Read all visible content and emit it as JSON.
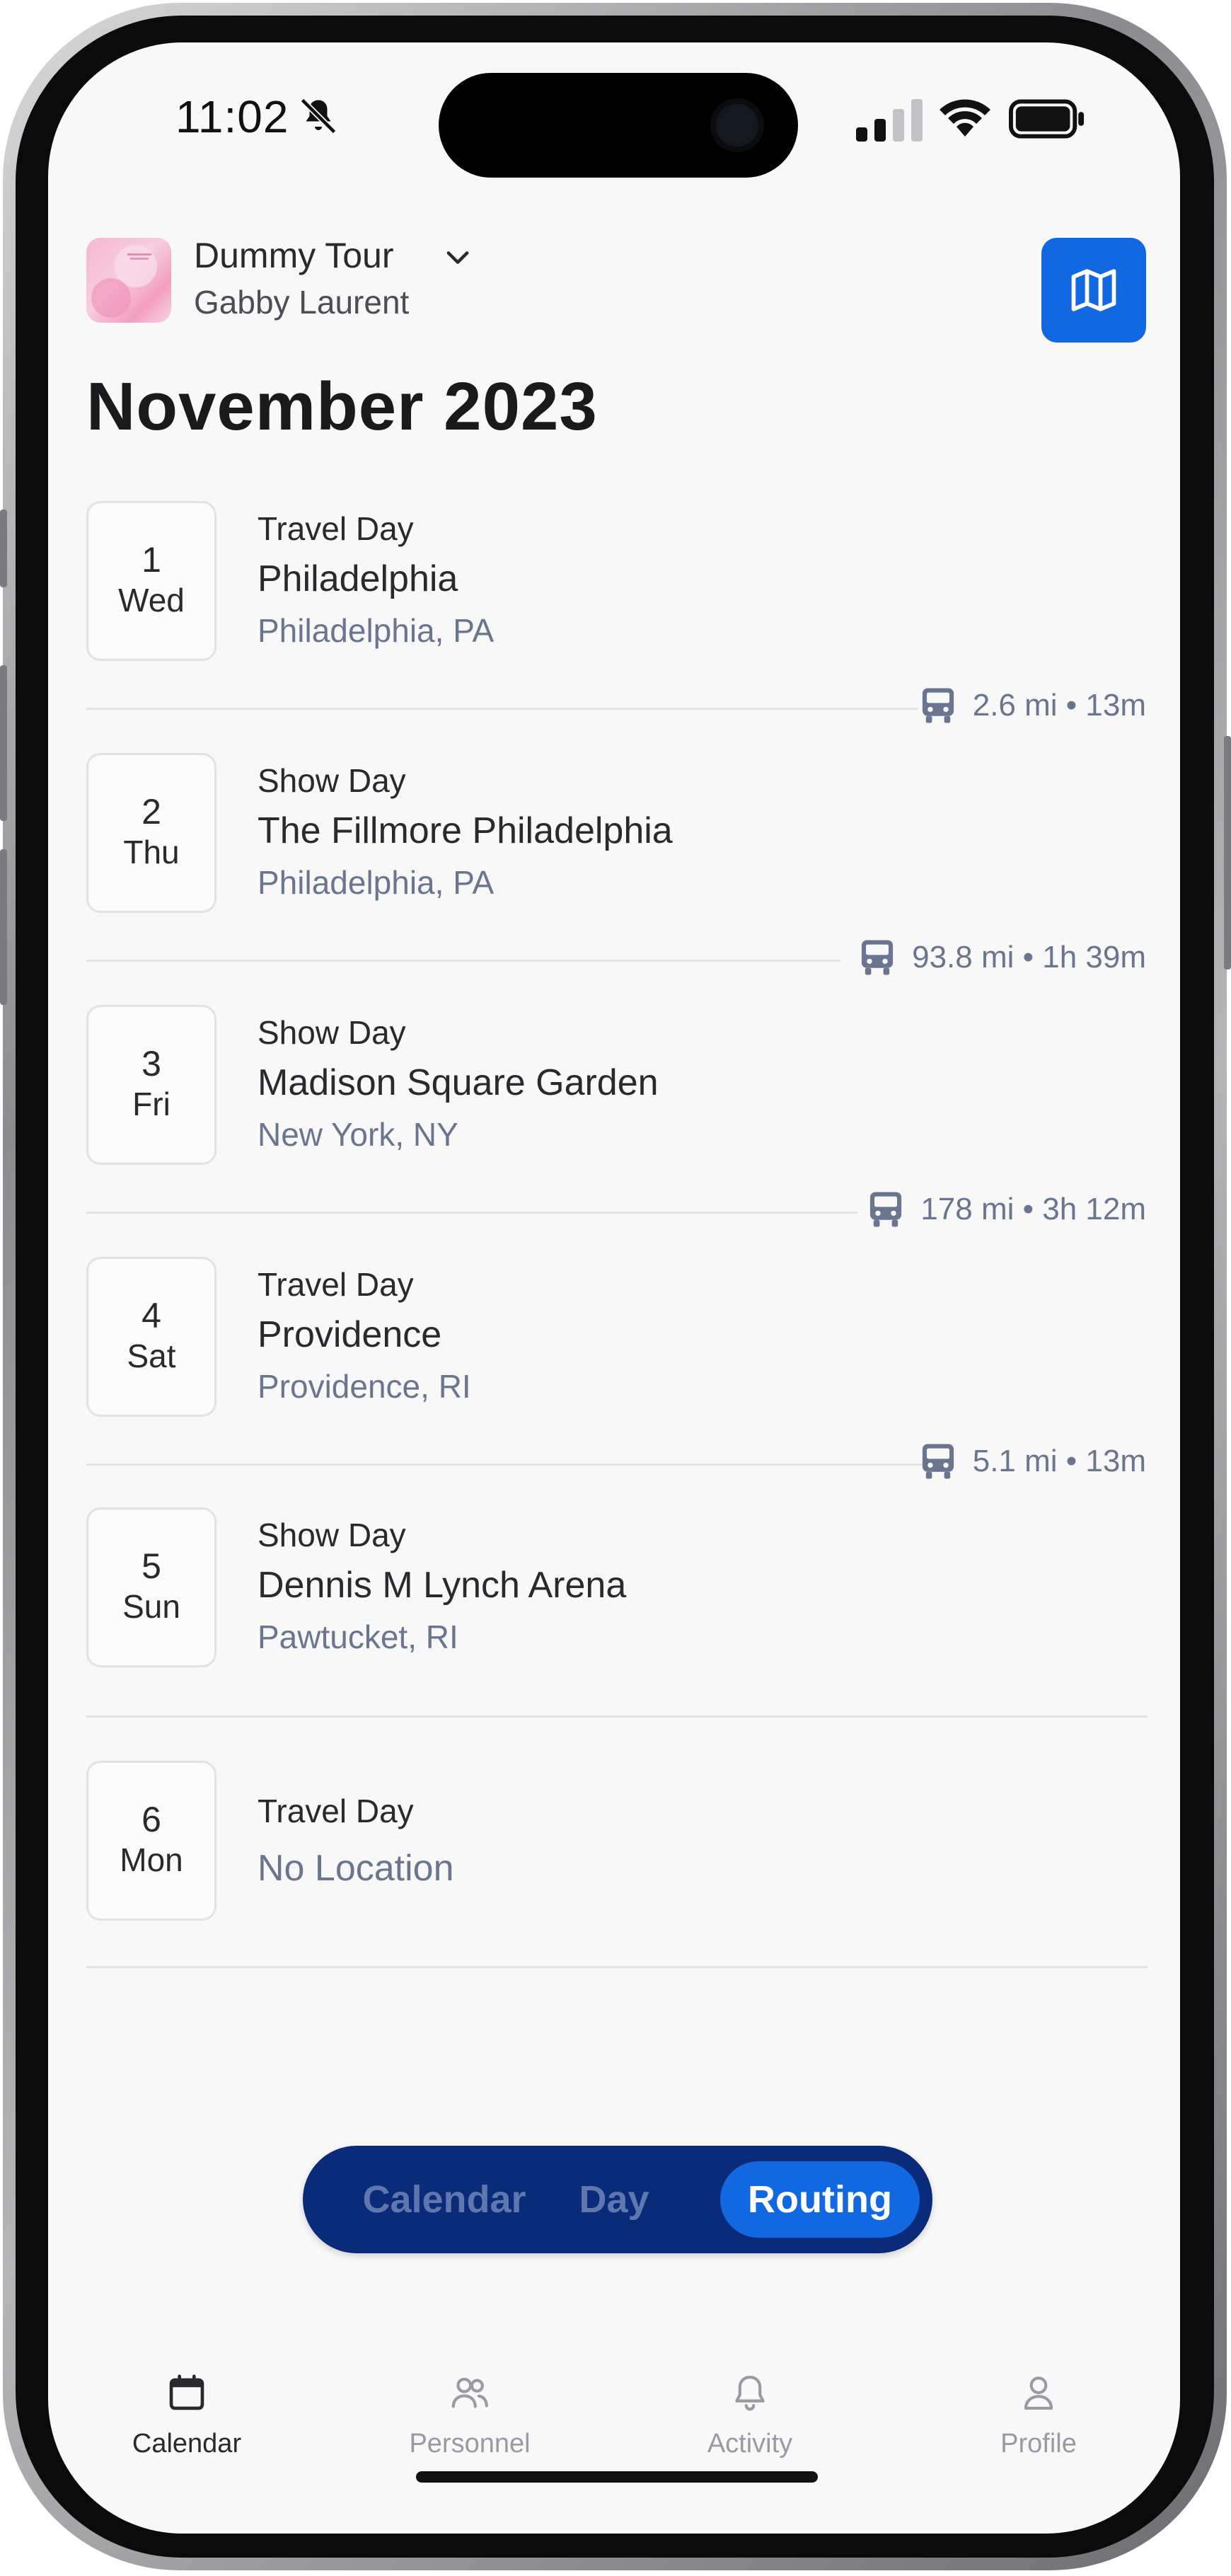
{
  "status_bar": {
    "time": "11:02"
  },
  "header": {
    "tour_name": "Dummy Tour",
    "person": "Gabby Laurent",
    "title": "November 2023"
  },
  "days": [
    {
      "num": "1",
      "dow": "Wed",
      "type": "Travel Day",
      "venue": "Philadelphia",
      "city": "Philadelphia, PA"
    },
    {
      "num": "2",
      "dow": "Thu",
      "type": "Show Day",
      "venue": "The Fillmore Philadelphia",
      "city": "Philadelphia, PA"
    },
    {
      "num": "3",
      "dow": "Fri",
      "type": "Show Day",
      "venue": "Madison Square Garden",
      "city": "New York, NY"
    },
    {
      "num": "4",
      "dow": "Sat",
      "type": "Travel Day",
      "venue": "Providence",
      "city": "Providence, RI"
    },
    {
      "num": "5",
      "dow": "Sun",
      "type": "Show Day",
      "venue": "Dennis M Lynch Arena",
      "city": "Pawtucket, RI"
    },
    {
      "num": "6",
      "dow": "Mon",
      "type": "Travel Day",
      "location": "No Location"
    }
  ],
  "travel": [
    "2.6 mi • 13m",
    "93.8 mi • 1h 39m",
    "178 mi • 3h 12m",
    "5.1 mi • 13m"
  ],
  "view_switcher": {
    "calendar": "Calendar",
    "day": "Day",
    "routing": "Routing",
    "selected": "Routing"
  },
  "tabs": [
    {
      "label": "Calendar",
      "icon": "calendar-icon",
      "active": true
    },
    {
      "label": "Personnel",
      "icon": "people-icon",
      "active": false
    },
    {
      "label": "Activity",
      "icon": "bell-icon",
      "active": false
    },
    {
      "label": "Profile",
      "icon": "person-icon",
      "active": false
    }
  ],
  "colors": {
    "accent": "#1268e0",
    "switcher_bg": "#0a2a7a",
    "secondary_text": "#6a7590"
  }
}
